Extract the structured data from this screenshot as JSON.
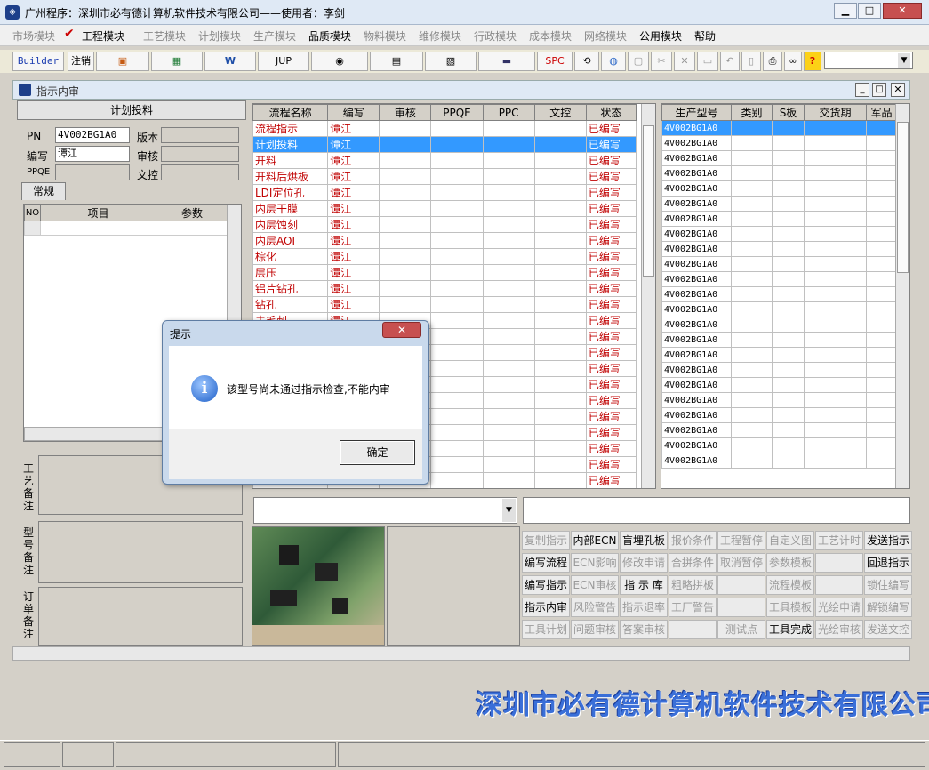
{
  "window": {
    "title": "广州程序：深圳市必有德计算机软件技术有限公司——使用者：李剑",
    "min": "▁",
    "max": "□",
    "close": "✕"
  },
  "menu": [
    "市场模块",
    "工程模块",
    "工艺模块",
    "计划模块",
    "生产模块",
    "品质模块",
    "物料模块",
    "维修模块",
    "行政模块",
    "成本模块",
    "网络模块",
    "公用模块",
    "帮助"
  ],
  "toolbar": {
    "builder": "Builder",
    "undo": "注销",
    "jup": "JUP",
    "spc": "SPC",
    "help": "?"
  },
  "child": {
    "title": "指示内审"
  },
  "left": {
    "section": "计划投料",
    "pn_label": "PN",
    "pn_value": "4V002BG1A0",
    "version_label": "版本",
    "editor_label": "编写",
    "editor_value": "谭江",
    "review_label": "审核",
    "ppqe_label": "PPQE",
    "doc_label": "文控",
    "tab": "常规",
    "grid_headers": [
      "NO",
      "项目",
      "参数"
    ]
  },
  "flow": {
    "headers": [
      "流程名称",
      "编写",
      "审核",
      "PPQE",
      "PPC",
      "文控",
      "状态"
    ],
    "rows": [
      {
        "name": "流程指示",
        "editor": "谭江",
        "status": "已编写"
      },
      {
        "name": "计划投料",
        "editor": "谭江",
        "status": "已编写"
      },
      {
        "name": "开料",
        "editor": "谭江",
        "status": "已编写"
      },
      {
        "name": "开料后烘板",
        "editor": "谭江",
        "status": "已编写"
      },
      {
        "name": "LDI定位孔",
        "editor": "谭江",
        "status": "已编写"
      },
      {
        "name": "内层干膜",
        "editor": "谭江",
        "status": "已编写"
      },
      {
        "name": "内层蚀刻",
        "editor": "谭江",
        "status": "已编写"
      },
      {
        "name": "内层AOI",
        "editor": "谭江",
        "status": "已编写"
      },
      {
        "name": "棕化",
        "editor": "谭江",
        "status": "已编写"
      },
      {
        "name": "层压",
        "editor": "谭江",
        "status": "已编写"
      },
      {
        "name": "铝片钻孔",
        "editor": "谭江",
        "status": "已编写"
      },
      {
        "name": "钻孔",
        "editor": "谭江",
        "status": "已编写"
      },
      {
        "name": "去毛刺",
        "editor": "谭江",
        "status": "已编写"
      },
      {
        "name": "",
        "editor": "",
        "status": "已编写"
      },
      {
        "name": "",
        "editor": "",
        "status": "已编写"
      },
      {
        "name": "",
        "editor": "",
        "status": "已编写"
      },
      {
        "name": "",
        "editor": "",
        "status": "已编写"
      },
      {
        "name": "",
        "editor": "",
        "status": "已编写"
      },
      {
        "name": "",
        "editor": "",
        "status": "已编写"
      },
      {
        "name": "",
        "editor": "",
        "status": "已编写"
      },
      {
        "name": "",
        "editor": "",
        "status": "已编写"
      },
      {
        "name": "",
        "editor": "",
        "status": "已编写"
      },
      {
        "name": "",
        "editor": "",
        "status": "已编写"
      },
      {
        "name": "",
        "editor": "",
        "status": "已编写"
      },
      {
        "name": "",
        "editor": "",
        "status": "已编写"
      }
    ]
  },
  "models": {
    "headers": [
      "生产型号",
      "类别",
      "S板",
      "交货期",
      "军品"
    ],
    "rows": [
      "4V002BG1A0",
      "4V002BG1A0",
      "4V002BG1A0",
      "4V002BG1A0",
      "4V002BG1A0",
      "4V002BG1A0",
      "4V002BG1A0",
      "4V002BG1A0",
      "4V002BG1A0",
      "4V002BG1A0",
      "4V002BG1A0",
      "4V002BG1A0",
      "4V002BG1A0",
      "4V002BG1A0",
      "4V002BG1A0",
      "4V002BG1A0",
      "4V002BG1A0",
      "4V002BG1A0",
      "4V002BG1A0",
      "4V002BG1A0",
      "4V002BG1A0",
      "4V002BG1A0",
      "4V002BG1A0"
    ]
  },
  "memos": [
    "工艺备注",
    "型号备注",
    "订单备注"
  ],
  "buttons": [
    [
      "复制指示",
      "内部ECN",
      "盲埋孔板",
      "报价条件",
      "工程暂停",
      "自定义图",
      "工艺计时",
      "发送指示"
    ],
    [
      "编写流程",
      "ECN影响",
      "修改申请",
      "合拼条件",
      "取消暂停",
      "参数模板",
      "",
      "回退指示"
    ],
    [
      "编写指示",
      "ECN审核",
      "指 示 库",
      "粗略拼板",
      "",
      "流程模板",
      "",
      "锁住编写"
    ],
    [
      "指示内审",
      "风险警告",
      "指示退率",
      "工厂警告",
      "",
      "工具模板",
      "光绘申请",
      "解锁编写"
    ],
    [
      "工具计划",
      "问题审核",
      "答案审核",
      "",
      "测试点",
      "工具完成",
      "光绘审核",
      "发送文控"
    ]
  ],
  "buttons_enabled": [
    [
      false,
      true,
      true,
      false,
      false,
      false,
      false,
      true
    ],
    [
      true,
      false,
      false,
      false,
      false,
      false,
      false,
      true
    ],
    [
      true,
      false,
      true,
      false,
      false,
      false,
      false,
      false
    ],
    [
      true,
      false,
      false,
      false,
      false,
      false,
      false,
      false
    ],
    [
      false,
      false,
      false,
      false,
      false,
      true,
      false,
      false
    ]
  ],
  "dialog": {
    "title": "提示",
    "message": "该型号尚未通过指示检查,不能内审",
    "ok": "确定"
  },
  "banner": "深圳市必有德计算机软件技术有限公司"
}
